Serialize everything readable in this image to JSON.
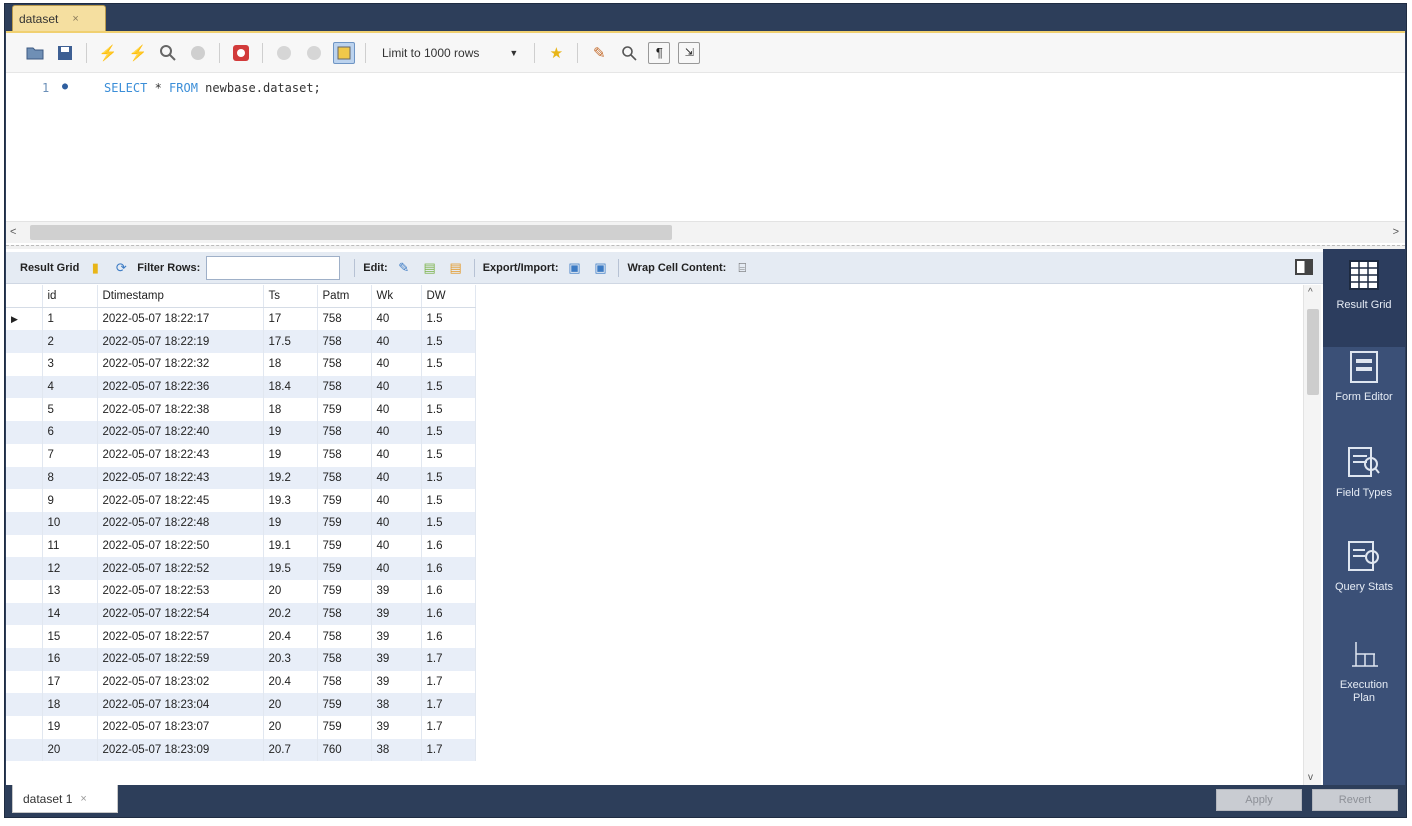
{
  "tab": {
    "title": "dataset",
    "close": "×"
  },
  "toolbar": {
    "limit_label": "Limit to 1000 rows",
    "icons": [
      "open-folder-icon",
      "save-icon",
      "execute-icon",
      "execute-current-icon",
      "explain-icon",
      "stop-icon",
      "toggle-errors-icon",
      "commit-icon",
      "rollback-icon",
      "autocommit-icon",
      "favorite-icon",
      "beautify-icon",
      "find-icon",
      "invisible-chars-icon",
      "wrap-icon"
    ]
  },
  "editor": {
    "line_number": "1",
    "sql_keyword_1": "SELECT",
    "sql_star": " * ",
    "sql_keyword_2": "FROM",
    "sql_rest": " newbase.dataset;"
  },
  "result_toolbar": {
    "result_grid": "Result Grid",
    "filter_rows": "Filter Rows:",
    "filter_value": "",
    "edit": "Edit:",
    "export_import": "Export/Import:",
    "wrap_cell": "Wrap Cell Content:"
  },
  "grid": {
    "columns": [
      "id",
      "Dtimestamp",
      "Ts",
      "Patm",
      "Wk",
      "DW"
    ],
    "rows": [
      [
        "1",
        "2022-05-07 18:22:17",
        "17",
        "758",
        "40",
        "1.5"
      ],
      [
        "2",
        "2022-05-07 18:22:19",
        "17.5",
        "758",
        "40",
        "1.5"
      ],
      [
        "3",
        "2022-05-07 18:22:32",
        "18",
        "758",
        "40",
        "1.5"
      ],
      [
        "4",
        "2022-05-07 18:22:36",
        "18.4",
        "758",
        "40",
        "1.5"
      ],
      [
        "5",
        "2022-05-07 18:22:38",
        "18",
        "759",
        "40",
        "1.5"
      ],
      [
        "6",
        "2022-05-07 18:22:40",
        "19",
        "758",
        "40",
        "1.5"
      ],
      [
        "7",
        "2022-05-07 18:22:43",
        "19",
        "758",
        "40",
        "1.5"
      ],
      [
        "8",
        "2022-05-07 18:22:43",
        "19.2",
        "758",
        "40",
        "1.5"
      ],
      [
        "9",
        "2022-05-07 18:22:45",
        "19.3",
        "759",
        "40",
        "1.5"
      ],
      [
        "10",
        "2022-05-07 18:22:48",
        "19",
        "759",
        "40",
        "1.5"
      ],
      [
        "11",
        "2022-05-07 18:22:50",
        "19.1",
        "759",
        "40",
        "1.6"
      ],
      [
        "12",
        "2022-05-07 18:22:52",
        "19.5",
        "759",
        "40",
        "1.6"
      ],
      [
        "13",
        "2022-05-07 18:22:53",
        "20",
        "759",
        "39",
        "1.6"
      ],
      [
        "14",
        "2022-05-07 18:22:54",
        "20.2",
        "758",
        "39",
        "1.6"
      ],
      [
        "15",
        "2022-05-07 18:22:57",
        "20.4",
        "758",
        "39",
        "1.6"
      ],
      [
        "16",
        "2022-05-07 18:22:59",
        "20.3",
        "758",
        "39",
        "1.7"
      ],
      [
        "17",
        "2022-05-07 18:23:02",
        "20.4",
        "758",
        "39",
        "1.7"
      ],
      [
        "18",
        "2022-05-07 18:23:04",
        "20",
        "759",
        "38",
        "1.7"
      ],
      [
        "19",
        "2022-05-07 18:23:07",
        "20",
        "759",
        "39",
        "1.7"
      ],
      [
        "20",
        "2022-05-07 18:23:09",
        "20.7",
        "760",
        "38",
        "1.7"
      ]
    ]
  },
  "side_panel": {
    "result_grid": "Result Grid",
    "form_editor": "Form Editor",
    "field_types": "Field Types",
    "query_stats": "Query Stats",
    "execution_plan": "Execution Plan"
  },
  "bottom": {
    "result_tab": "dataset 1",
    "close": "×",
    "apply": "Apply",
    "revert": "Revert"
  },
  "colors": {
    "frame": "#2d3e5a",
    "tab": "#f5dfa0",
    "side_panel": "#3b5077",
    "row_alt": "#e8eef8",
    "keyword": "#3b8ed8"
  }
}
